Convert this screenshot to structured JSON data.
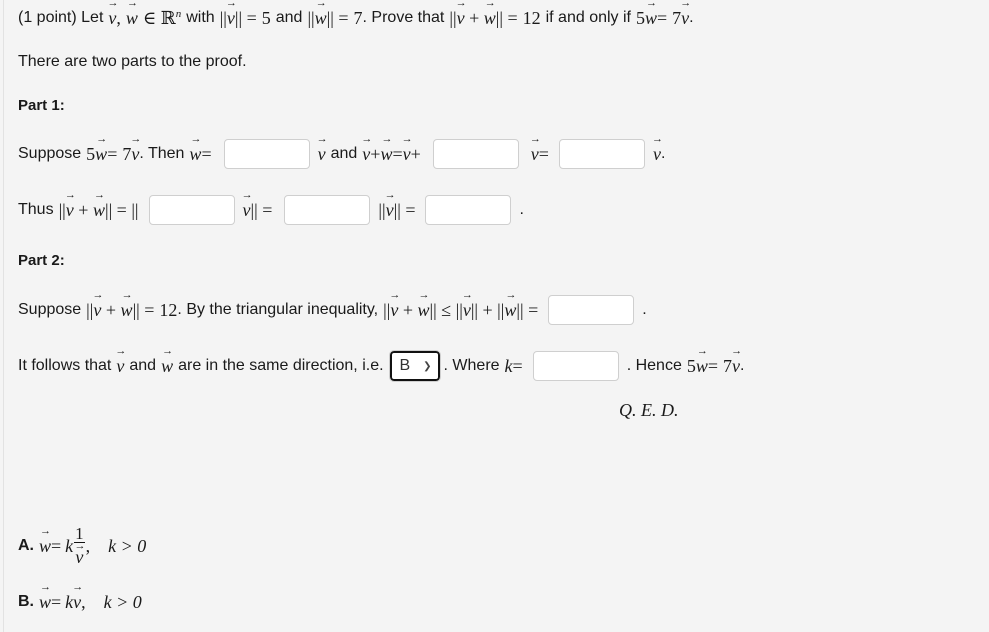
{
  "problem": {
    "points_label": "(1 point) Let",
    "vectors": "v, w",
    "in_symbol": "∈ ℝ",
    "n_exp": "n",
    "with_label": "with",
    "norm_v_value": "5",
    "and_label": "and",
    "norm_w_value": "7",
    "prove_that": ". Prove that",
    "sum_norm_value": "12",
    "iff_label": "if and only if",
    "coef_w": "5",
    "coef_v": "7"
  },
  "intro": "There are two parts to the proof.",
  "part1": {
    "heading": "Part 1:",
    "suppose": "Suppose",
    "then_w": ". Then",
    "and_label": "and",
    "inputs": {
      "w_coefficient": "",
      "sum_term": "",
      "sum_coefficient": "",
      "norm_coefficient": "",
      "norm_value": "",
      "final_value": ""
    },
    "thus": "Thus"
  },
  "part2": {
    "heading": "Part 2:",
    "suppose": "Suppose",
    "triangle_text": ". By the triangular inequality,",
    "follows_text": "It follows that",
    "same_direction": "are in the same direction, i.e.",
    "select_value": "B",
    "where_label": ". Where",
    "hence_label": ". Hence",
    "qed": "Q. E. D.",
    "inputs": {
      "triangle_sum": "",
      "k_value": ""
    }
  },
  "options": [
    {
      "letter": "A.",
      "condition": "k > 0",
      "text": "w = k (1/v), k > 0"
    },
    {
      "letter": "B.",
      "condition": "k > 0",
      "text": "w = k v, k > 0"
    }
  ]
}
